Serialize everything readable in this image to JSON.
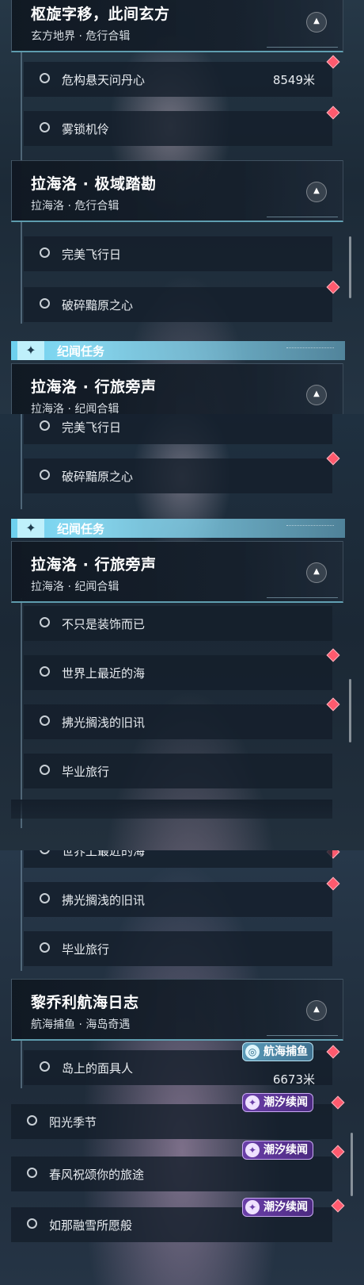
{
  "panel1": {
    "header_top": {
      "title": "枢旋字移，此间玄方",
      "subtitle": "玄方地界 · 危行合辑"
    },
    "quests_top": [
      {
        "label": "危构悬天问丹心",
        "distance": "8549米"
      },
      {
        "label": "雾锁机伶",
        "distance": ""
      }
    ],
    "header2": {
      "title": "拉海洛 · 极域踏勘",
      "subtitle": "拉海洛 · 危行合辑"
    },
    "quests2": [
      {
        "label": "完美飞行日"
      },
      {
        "label": "破碎黯原之心"
      }
    ],
    "banner": {
      "text": "纪闻任务"
    },
    "header3": {
      "title": "拉海洛 · 行旅旁声",
      "subtitle": "拉海洛 · 纪闻合辑"
    }
  },
  "panel2": {
    "quests_a": [
      {
        "label": "完美飞行日"
      },
      {
        "label": "破碎黯原之心"
      }
    ],
    "banner": {
      "text": "纪闻任务"
    },
    "header": {
      "title": "拉海洛 · 行旅旁声",
      "subtitle": "拉海洛 · 纪闻合辑"
    },
    "quests_b": [
      {
        "label": "不只是装饰而已"
      },
      {
        "label": "世界上最近的海"
      },
      {
        "label": "拂光搁浅的旧讯"
      },
      {
        "label": "毕业旅行"
      }
    ]
  },
  "panel3": {
    "quests_a": [
      {
        "label": "世界上最近的海"
      },
      {
        "label": "拂光搁浅的旧讯"
      },
      {
        "label": "毕业旅行"
      }
    ],
    "header": {
      "title": "黎乔利航海日志",
      "subtitle": "航海捕鱼 · 海岛奇遇"
    },
    "quests_b": [
      {
        "label": "岛上的面具人",
        "distance": "6673米",
        "tag": "航海捕鱼"
      },
      {
        "label": "阳光季节",
        "tag": "潮汐续闻"
      },
      {
        "label": "春风祝颂你的旅途",
        "tag": "潮汐续闻"
      },
      {
        "label": "如那融雪所愿般",
        "tag": "潮汐续闻"
      }
    ]
  },
  "icons": {
    "collapse": "chevron-up-icon",
    "status": "circle-icon",
    "marker": "diamond-marker-icon",
    "banner": "sparkle-icon"
  },
  "colors": {
    "accent": "#7fd4ef",
    "marker": "#ff5a6e",
    "tide_tag": "#5b3594",
    "fish_tag": "#4a86a6"
  }
}
